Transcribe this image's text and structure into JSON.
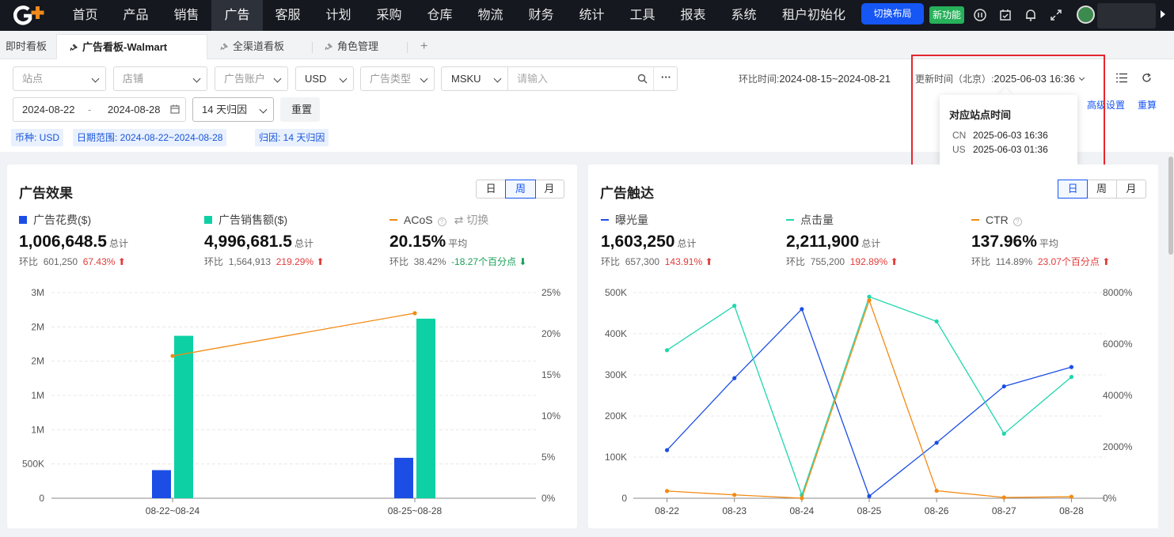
{
  "nav": {
    "items": [
      "首页",
      "产品",
      "销售",
      "广告",
      "客服",
      "计划",
      "采购",
      "仓库",
      "物流",
      "财务",
      "统计",
      "工具",
      "报表",
      "系统",
      "租户初始化"
    ],
    "active_index": 3,
    "switch_layout": "切换布局",
    "new_feature": "新功能"
  },
  "tabs": {
    "items": [
      {
        "label": "即时看板",
        "pinned": false
      },
      {
        "label": "广告看板-Walmart",
        "pinned": true
      },
      {
        "label": "全渠道看板",
        "pinned": true
      },
      {
        "label": "角色管理",
        "pinned": true
      }
    ],
    "active_index": 1,
    "add_symbol": "+"
  },
  "filters": {
    "site_placeholder": "站点",
    "store_placeholder": "店铺",
    "ad_account_placeholder": "广告账户",
    "currency": "USD",
    "ad_type_placeholder": "广告类型",
    "sku_type": "MSKU",
    "search_placeholder": "请输入",
    "more_symbol": "···",
    "date_start": "2024-08-22",
    "date_sep": "-",
    "date_end": "2024-08-28",
    "attribution": "14 天归因",
    "reset": "重置",
    "compare_label": "环比时间:",
    "compare_range": "2024-08-15~2024-08-21",
    "update_label": "更新时间（北京）:",
    "update_time": "2025-06-03 16:36",
    "advanced": "高级设置",
    "recalc": "重算"
  },
  "tags": [
    "币种: USD",
    "日期范围: 2024-08-22~2024-08-28",
    "归因: 14 天归因"
  ],
  "popup": {
    "title": "对应站点时间",
    "rows": [
      {
        "site": "CN",
        "time": "2025-06-03 16:36"
      },
      {
        "site": "US",
        "time": "2025-06-03 01:36"
      }
    ]
  },
  "left_card": {
    "title": "广告效果",
    "periods": [
      "日",
      "周",
      "月"
    ],
    "active_period": 1,
    "switch_label": "切换",
    "metrics": [
      {
        "label": "广告花费($)",
        "value": "1,006,648.5",
        "suffix": "总计",
        "cmp_label": "环比",
        "cmp_value": "601,250",
        "change": "67.43%",
        "dir": "up",
        "color": "#1c4ee6"
      },
      {
        "label": "广告销售额($)",
        "value": "4,996,681.5",
        "suffix": "总计",
        "cmp_label": "环比",
        "cmp_value": "1,564,913",
        "change": "219.29%",
        "dir": "up",
        "color": "#0dd1a4"
      },
      {
        "label": "ACoS",
        "value": "20.15%",
        "suffix": "平均",
        "cmp_label": "环比",
        "cmp_value": "38.42%",
        "change": "-18.27个百分点",
        "dir": "down",
        "color": "#f28a12"
      }
    ]
  },
  "right_card": {
    "title": "广告触达",
    "periods": [
      "日",
      "周",
      "月"
    ],
    "active_period": 0,
    "metrics": [
      {
        "label": "曝光量",
        "value": "1,603,250",
        "suffix": "总计",
        "cmp_label": "环比",
        "cmp_value": "657,300",
        "change": "143.91%",
        "dir": "up",
        "color": "#1c4ee6"
      },
      {
        "label": "点击量",
        "value": "2,211,900",
        "suffix": "总计",
        "cmp_label": "环比",
        "cmp_value": "755,200",
        "change": "192.89%",
        "dir": "up",
        "color": "#1ed6ae"
      },
      {
        "label": "CTR",
        "value": "137.96%",
        "suffix": "平均",
        "cmp_label": "环比",
        "cmp_value": "114.89%",
        "change": "23.07个百分点",
        "dir": "up",
        "color": "#f28a12"
      }
    ]
  },
  "chart_data": [
    {
      "type": "bar",
      "categories": [
        "08-22~08-24",
        "08-25~08-28"
      ],
      "series": [
        {
          "name": "广告花费($)",
          "kind": "bar",
          "axis": "left",
          "values": [
            410000,
            590000
          ],
          "color": "#1c4ee6"
        },
        {
          "name": "广告销售额($)",
          "kind": "bar",
          "axis": "left",
          "values": [
            2370000,
            2620000
          ],
          "color": "#0dd1a4"
        },
        {
          "name": "ACoS",
          "kind": "line",
          "axis": "right",
          "values": [
            17.3,
            22.5
          ],
          "color": "#f28a12"
        }
      ],
      "left_ticks": [
        "0",
        "500K",
        "1M",
        "1M",
        "2M",
        "2M",
        "3M"
      ],
      "right_ticks": [
        "0%",
        "5%",
        "10%",
        "15%",
        "20%",
        "25%"
      ],
      "ylim": [
        0,
        3000000
      ],
      "y2lim": [
        0,
        25
      ],
      "grid": true
    },
    {
      "type": "line",
      "categories": [
        "08-22",
        "08-23",
        "08-24",
        "08-25",
        "08-26",
        "08-27",
        "08-28"
      ],
      "series": [
        {
          "name": "曝光量",
          "axis": "left",
          "values": [
            117000,
            292000,
            460000,
            5000,
            135000,
            272000,
            319000
          ],
          "color": "#1c4ee6"
        },
        {
          "name": "点击量",
          "axis": "left",
          "values": [
            360000,
            468000,
            8000,
            490000,
            430000,
            157000,
            295000
          ],
          "color": "#1ed6ae"
        },
        {
          "name": "CTR",
          "axis": "right",
          "values": [
            280,
            130,
            5,
            7700,
            290,
            30,
            60
          ],
          "color": "#f28a12"
        }
      ],
      "left_ticks": [
        "0",
        "100K",
        "200K",
        "300K",
        "400K",
        "500K"
      ],
      "right_ticks": [
        "0%",
        "2000%",
        "4000%",
        "6000%",
        "8000%"
      ],
      "ylim": [
        0,
        500000
      ],
      "y2lim": [
        0,
        8000
      ],
      "grid": true
    }
  ]
}
